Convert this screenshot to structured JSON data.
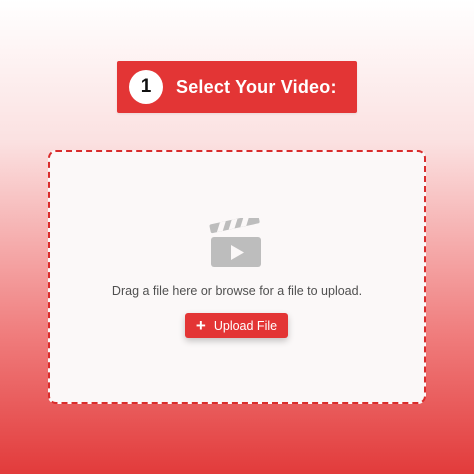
{
  "step": {
    "number": "1",
    "title": "Select Your Video:"
  },
  "dropzone": {
    "icon": "video-clapperboard-icon",
    "instructions": "Drag a file here or browse for a file to upload.",
    "button": {
      "icon": "plus-icon",
      "icon_glyph": "+",
      "label": "Upload File"
    }
  },
  "colors": {
    "accent": "#e33535",
    "border": "#d92c2c",
    "icon_gray": "#bdbdbd",
    "text_gray": "#505050"
  }
}
